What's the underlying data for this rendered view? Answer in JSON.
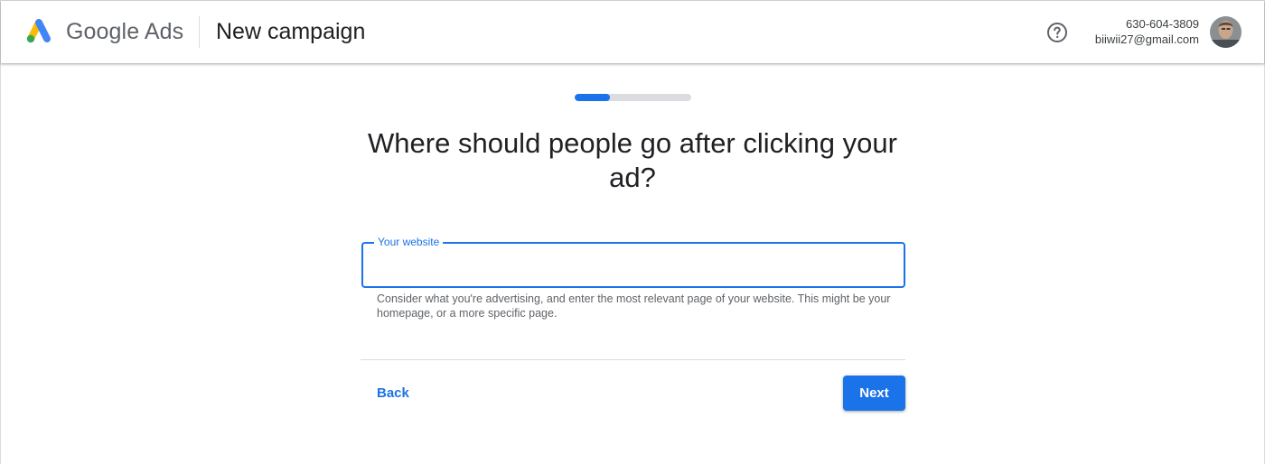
{
  "header": {
    "brand": "Google Ads",
    "title": "New campaign",
    "help_icon": "help-circle-icon",
    "account": {
      "phone": "630-604-3809",
      "email": "biiwii27@gmail.com"
    }
  },
  "progress": {
    "fraction": 0.3
  },
  "main": {
    "question": "Where should people go after clicking your ad?",
    "website_field": {
      "label": "Your website",
      "value": "",
      "placeholder": ""
    },
    "hint": "Consider what you're advertising, and enter the most relevant page of your website. This might be your homepage, or a more specific page.",
    "back_label": "Back",
    "next_label": "Next"
  },
  "colors": {
    "accent": "#1a73e8",
    "logo_blue": "#4285f4",
    "logo_yellow": "#fbbc04",
    "logo_green": "#34a853"
  }
}
